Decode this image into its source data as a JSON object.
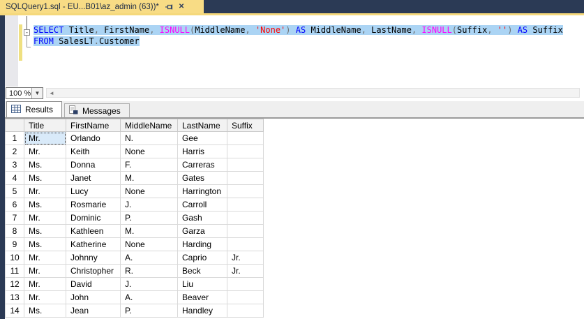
{
  "window": {
    "frame_color": "#2B3A55",
    "active_tab_color": "#F8DC85",
    "selection_color": "#ABD4F4"
  },
  "tab": {
    "title": "SQLQuery1.sql - EU...B01\\az_admin (63))*"
  },
  "icons": {
    "pin": "pin-icon",
    "close": "✕",
    "fold_collapse": "-",
    "dropdown": "▼",
    "scroll_left": "◄",
    "results_tab": "grid-icon",
    "messages_tab": "message-page-icon"
  },
  "editor": {
    "lines": [
      {
        "tokens": [
          [
            "kw",
            "SELECT "
          ],
          [
            "id",
            "Title"
          ],
          [
            "pu",
            ", "
          ],
          [
            "id",
            "FirstName"
          ],
          [
            "pu",
            ", "
          ],
          [
            "fn",
            "ISNULL"
          ],
          [
            "pu",
            "("
          ],
          [
            "id",
            "MiddleName"
          ],
          [
            "pu",
            ", "
          ],
          [
            "st",
            "'None'"
          ],
          [
            "pu",
            ") "
          ],
          [
            "kw",
            "AS "
          ],
          [
            "id",
            "MiddleName"
          ],
          [
            "pu",
            ", "
          ],
          [
            "id",
            "LastName"
          ],
          [
            "pu",
            ", "
          ],
          [
            "fn",
            "ISNULL"
          ],
          [
            "pu",
            "("
          ],
          [
            "id",
            "Suffix"
          ],
          [
            "pu",
            ", "
          ],
          [
            "st",
            "''"
          ],
          [
            "pu",
            ") "
          ],
          [
            "kw",
            "AS "
          ],
          [
            "id",
            "Suffix"
          ]
        ]
      },
      {
        "tokens": [
          [
            "kw",
            "FROM "
          ],
          [
            "id",
            "SalesLT"
          ],
          [
            "pu",
            "."
          ],
          [
            "id",
            "Customer"
          ]
        ]
      }
    ]
  },
  "zoom_control": {
    "value": "100 %"
  },
  "results_pane": {
    "tabs": [
      {
        "label": "Results",
        "active": true
      },
      {
        "label": "Messages",
        "active": false
      }
    ]
  },
  "grid": {
    "columns": [
      "",
      "Title",
      "FirstName",
      "MiddleName",
      "LastName",
      "Suffix"
    ],
    "rows": [
      [
        "1",
        "Mr.",
        "Orlando",
        "N.",
        "Gee",
        ""
      ],
      [
        "2",
        "Mr.",
        "Keith",
        "None",
        "Harris",
        ""
      ],
      [
        "3",
        "Ms.",
        "Donna",
        "F.",
        "Carreras",
        ""
      ],
      [
        "4",
        "Ms.",
        "Janet",
        "M.",
        "Gates",
        ""
      ],
      [
        "5",
        "Mr.",
        "Lucy",
        "None",
        "Harrington",
        ""
      ],
      [
        "6",
        "Ms.",
        "Rosmarie",
        "J.",
        "Carroll",
        ""
      ],
      [
        "7",
        "Mr.",
        "Dominic",
        "P.",
        "Gash",
        ""
      ],
      [
        "8",
        "Ms.",
        "Kathleen",
        "M.",
        "Garza",
        ""
      ],
      [
        "9",
        "Ms.",
        "Katherine",
        "None",
        "Harding",
        ""
      ],
      [
        "10",
        "Mr.",
        "Johnny",
        "A.",
        "Caprio",
        "Jr."
      ],
      [
        "11",
        "Mr.",
        "Christopher",
        "R.",
        "Beck",
        "Jr."
      ],
      [
        "12",
        "Mr.",
        "David",
        "J.",
        "Liu",
        ""
      ],
      [
        "13",
        "Mr.",
        "John",
        "A.",
        "Beaver",
        ""
      ],
      [
        "14",
        "Ms.",
        "Jean",
        "P.",
        "Handley",
        ""
      ]
    ],
    "focused_cell": {
      "row": 0,
      "col": 1
    }
  }
}
